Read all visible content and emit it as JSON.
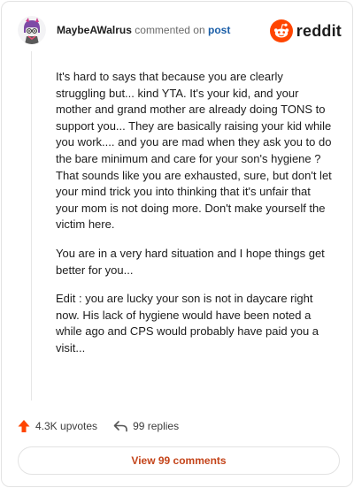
{
  "header": {
    "username": "MaybeAWalrus",
    "action_text": "commented on",
    "post_link": "post",
    "brand_wordmark": "reddit",
    "brand_color": "#ff4500"
  },
  "comment": {
    "paragraphs": [
      "It's hard to says that because you are clearly struggling but... kind YTA. It's your kid, and your mother and grand mother are already doing TONS to support you... They are basically raising your kid while you work.... and you are mad when they ask you to do the bare minimum and care for your son's hygiene ? That sounds like you are exhausted, sure, but don't let your mind trick you into thinking that it's unfair that your mom is not doing more. Don't make yourself the victim here.",
      "You are in a very hard situation and I hope things get better for you...",
      "Edit : you are lucky your son is not in daycare right now. His lack of hygiene would have been noted a while ago and CPS would probably have paid you a visit..."
    ]
  },
  "actions": {
    "upvotes": "4.3K upvotes",
    "replies": "99 replies",
    "upvote_icon": "upvote-arrow-icon",
    "reply_icon": "reply-arrow-icon",
    "upvote_color": "#ff4500"
  },
  "footer": {
    "view_comments": "View 99 comments",
    "link_color": "#c4451b"
  }
}
